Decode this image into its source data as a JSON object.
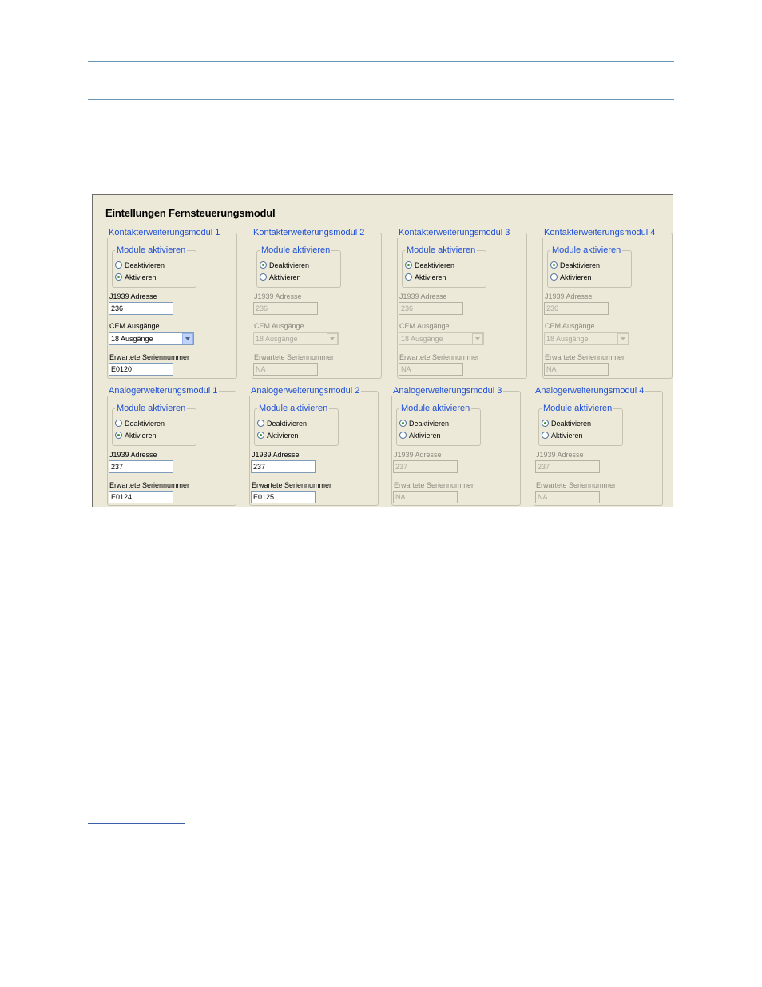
{
  "panel_title": "Eintellungen Fernsteuerungsmodul",
  "contact_modules": [
    {
      "title": "Kontakterweiterungsmodul 1",
      "activate_label": "Module aktivieren",
      "deactivate": "Deaktivieren",
      "activate": "Aktivieren",
      "selected": "Aktivieren",
      "address_label": "J1939 Adresse",
      "address": "236",
      "outputs_label": "CEM Ausgänge",
      "outputs": "18 Ausgänge",
      "serial_label": "Erwartete Seriennummer",
      "serial": "E0120",
      "enabled": true
    },
    {
      "title": "Kontakterweiterungsmodul 2",
      "activate_label": "Module aktivieren",
      "deactivate": "Deaktivieren",
      "activate": "Aktivieren",
      "selected": "Deaktivieren",
      "address_label": "J1939 Adresse",
      "address": "236",
      "outputs_label": "CEM Ausgänge",
      "outputs": "18 Ausgänge",
      "serial_label": "Erwartete Seriennummer",
      "serial": "NA",
      "enabled": false
    },
    {
      "title": "Kontakterweiterungsmodul 3",
      "activate_label": "Module aktivieren",
      "deactivate": "Deaktivieren",
      "activate": "Aktivieren",
      "selected": "Deaktivieren",
      "address_label": "J1939 Adresse",
      "address": "236",
      "outputs_label": "CEM Ausgänge",
      "outputs": "18 Ausgänge",
      "serial_label": "Erwartete Seriennummer",
      "serial": "NA",
      "enabled": false
    },
    {
      "title": "Kontakterweiterungsmodul 4",
      "activate_label": "Module aktivieren",
      "deactivate": "Deaktivieren",
      "activate": "Aktivieren",
      "selected": "Deaktivieren",
      "address_label": "J1939 Adresse",
      "address": "236",
      "outputs_label": "CEM Ausgänge",
      "outputs": "18 Ausgänge",
      "serial_label": "Erwartete Seriennummer",
      "serial": "NA",
      "enabled": false
    }
  ],
  "analog_modules": [
    {
      "title": "Analogerweiterungsmodul 1",
      "activate_label": "Module aktivieren",
      "deactivate": "Deaktivieren",
      "activate": "Aktivieren",
      "selected": "Aktivieren",
      "address_label": "J1939 Adresse",
      "address": "237",
      "serial_label": "Erwartete Seriennummer",
      "serial": "E0124",
      "enabled": true
    },
    {
      "title": "Analogerweiterungsmodul 2",
      "activate_label": "Module aktivieren",
      "deactivate": "Deaktivieren",
      "activate": "Aktivieren",
      "selected": "Aktivieren",
      "address_label": "J1939 Adresse",
      "address": "237",
      "serial_label": "Erwartete Seriennummer",
      "serial": "E0125",
      "enabled": true
    },
    {
      "title": "Analogerweiterungsmodul 3",
      "activate_label": "Module aktivieren",
      "deactivate": "Deaktivieren",
      "activate": "Aktivieren",
      "selected": "Deaktivieren",
      "address_label": "J1939 Adresse",
      "address": "237",
      "serial_label": "Erwartete Seriennummer",
      "serial": "NA",
      "enabled": false
    },
    {
      "title": "Analogerweiterungsmodul 4",
      "activate_label": "Module aktivieren",
      "deactivate": "Deaktivieren",
      "activate": "Aktivieren",
      "selected": "Deaktivieren",
      "address_label": "J1939 Adresse",
      "address": "237",
      "serial_label": "Erwartete Seriennummer",
      "serial": "NA",
      "enabled": false
    }
  ],
  "colors": {
    "legend": "#1d4fd8",
    "panel_bg": "#ece9d8",
    "rule": "#6a97b8"
  }
}
